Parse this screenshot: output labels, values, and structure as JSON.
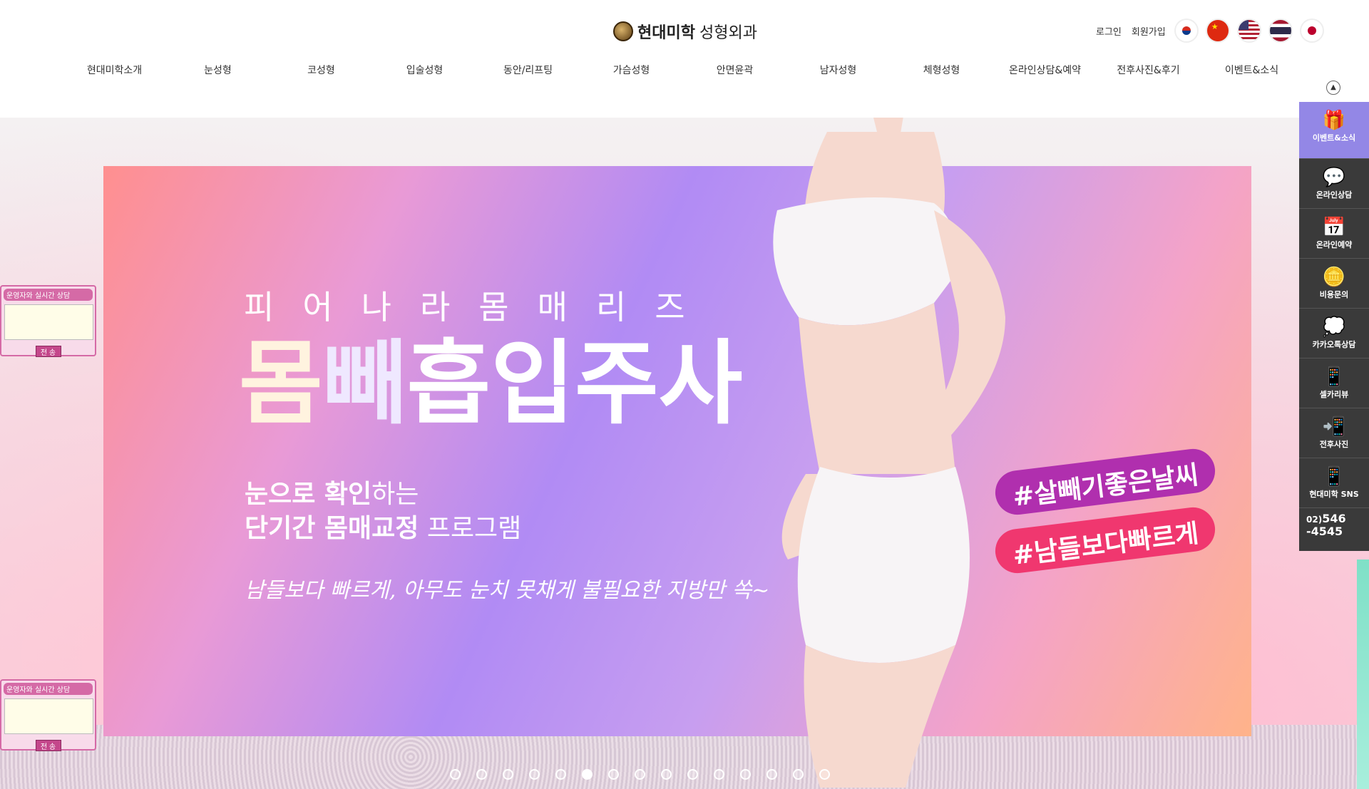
{
  "header": {
    "logo_bold": "현대미학",
    "logo_text": "성형외과",
    "util_links": [
      "로그인",
      "회원가입"
    ],
    "flags": [
      "kr-flag-icon",
      "cn-flag-icon",
      "us-flag-icon",
      "th-flag-icon",
      "jp-flag-icon"
    ]
  },
  "gnb": [
    "현대미학소개",
    "눈성형",
    "코성형",
    "입술성형",
    "동안/리프팅",
    "가슴성형",
    "안면윤곽",
    "남자성형",
    "체형성형",
    "온라인상담&예약",
    "전후사진&후기",
    "이벤트&소식"
  ],
  "hero": {
    "subtitle": "피어나라몸매리즈",
    "title_p1": "몸",
    "title_p2": "빼",
    "title_p3": "흡입주사",
    "desc1_bold": "눈으로 확인",
    "desc1_rest": "하는",
    "desc2_bold": "단기간 몸매교정",
    "desc2_rest": " 프로그램",
    "handwrite": "남들보다 빠르게, 아무도 눈치 못채게 불필요한 지방만 쏙~",
    "tag1": "#살빼기좋은날씨",
    "tag2": "#남들보다빠르게",
    "slide_count": 15,
    "active_slide": 5
  },
  "chat": {
    "header": "운영자와 실시간 상담",
    "send": "전 송"
  },
  "quick": {
    "top": "▲",
    "items": [
      {
        "label": "이벤트&소식",
        "icon": "🎁"
      },
      {
        "label": "온라인상담",
        "icon": "💬"
      },
      {
        "label": "온라인예약",
        "icon": "📅"
      },
      {
        "label": "비용문의",
        "icon": "🪙"
      },
      {
        "label": "카카오톡상담",
        "icon": "💭"
      },
      {
        "label": "셀카리뷰",
        "icon": "📱"
      },
      {
        "label": "전후사진",
        "icon": "📲"
      },
      {
        "label": "현대미학 SNS",
        "icon": "📱"
      }
    ],
    "phone_prefix": "02)",
    "phone_1": "546",
    "phone_2": "-4545"
  },
  "colors": {
    "accent_purple": "#9387e6",
    "quick_bg": "#3a3a3a",
    "tag1": "#b02fae",
    "tag2": "#f0376f"
  }
}
